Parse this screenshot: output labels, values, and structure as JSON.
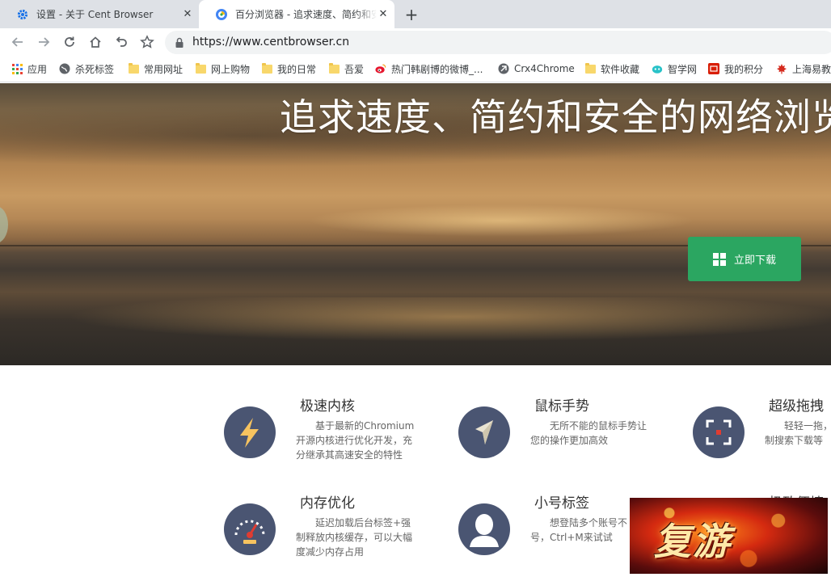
{
  "tabs": [
    {
      "title": "设置 - 关于 Cent Browser",
      "icon": "gear-icon",
      "active": false
    },
    {
      "title": "百分浏览器 - 追求速度、简约和安全的网络浏览器",
      "icon": "cent-browser-icon",
      "active": true
    }
  ],
  "toolbar": {
    "url": "https://www.centbrowser.cn"
  },
  "bookmarks": [
    {
      "label": "应用",
      "icon": "apps-grid-icon"
    },
    {
      "label": "杀死标签",
      "icon": "globe-icon"
    },
    {
      "label": "常用网址",
      "icon": "folder-icon"
    },
    {
      "label": "网上购物",
      "icon": "folder-icon"
    },
    {
      "label": "我的日常",
      "icon": "folder-icon"
    },
    {
      "label": "吾爱",
      "icon": "folder-icon"
    },
    {
      "label": "热门韩剧博的微博_...",
      "icon": "weibo-icon"
    },
    {
      "label": "Crx4Chrome",
      "icon": "crx-icon"
    },
    {
      "label": "软件收藏",
      "icon": "folder-icon"
    },
    {
      "label": "智学网",
      "icon": "zhixue-icon"
    },
    {
      "label": "我的积分",
      "icon": "points-icon"
    },
    {
      "label": "上海易教",
      "icon": "maple-icon"
    }
  ],
  "hero": {
    "title": "追求速度、简约和安全的网络浏览器",
    "download_label": "立即下载"
  },
  "features": [
    {
      "title": "极速内核",
      "desc": "基于最新的Chromium开源内核进行优化开发，充分继承其高速安全的特性",
      "icon": "lightning-icon"
    },
    {
      "title": "鼠标手势",
      "desc": "无所不能的鼠标手势让您的操作更加高效",
      "icon": "cursor-arrow-icon"
    },
    {
      "title": "超级拖拽",
      "desc": "轻轻一拖，复制搜索下载等",
      "icon": "drag-frame-icon"
    },
    {
      "title": "内存优化",
      "desc": "延迟加载后台标签+强制释放内核缓存，可以大幅度减少内存占用",
      "icon": "gauge-icon"
    },
    {
      "title": "小号标签",
      "desc": "想登陆多个账号不号，Ctrl+M来试试",
      "icon": "user-silhouette-icon"
    },
    {
      "title": "极致便捷",
      "desc": "",
      "icon": "convenience-icon"
    }
  ],
  "promo": {
    "text": "复游"
  },
  "colors": {
    "download_green": "#2ba661",
    "feature_circle": "#4a5572",
    "accent_yellow": "#f7c35f"
  }
}
